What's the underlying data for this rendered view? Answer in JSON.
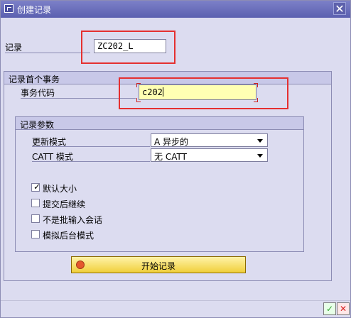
{
  "window": {
    "title": "创建记录"
  },
  "recording": {
    "label": "记录",
    "value": "ZC202_L"
  },
  "record_first_transaction": {
    "group_title": "记录首个事务",
    "transaction_code_label": "事务代码",
    "transaction_code_value": "c202"
  },
  "recording_parameters": {
    "group_title": "记录参数",
    "update_mode_label": "更新模式",
    "update_mode_value": "A 异步的",
    "catt_mode_label": "CATT 模式",
    "catt_mode_value": "无 CATT",
    "checkboxes": [
      {
        "label": "默认大小",
        "checked": true
      },
      {
        "label": "提交后继续",
        "checked": false
      },
      {
        "label": "不是批输入会话",
        "checked": false
      },
      {
        "label": "模拟后台模式",
        "checked": false
      }
    ]
  },
  "buttons": {
    "start_recording": "开始记录",
    "ok": "✓",
    "cancel": "✕",
    "close": "✕"
  },
  "icons": {
    "title_icon": "window-icon",
    "start_icon": "record-icon",
    "ok_icon": "check-icon",
    "cancel_icon": "cancel-icon"
  },
  "colors": {
    "input_highlight": "#ffffb3",
    "start_button": "#f0cf3b",
    "annotation": "#e53030",
    "ok": "#2d9f2d",
    "cancel": "#d62020"
  }
}
